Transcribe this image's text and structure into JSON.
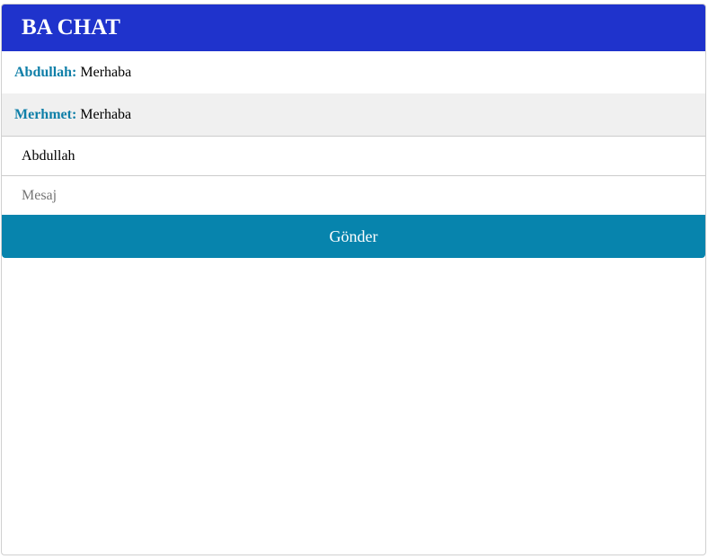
{
  "header": {
    "title": "BA CHAT"
  },
  "messages": [
    {
      "sender": "Abdullah:",
      "text": "Merhaba"
    },
    {
      "sender": "Merhmet:",
      "text": "Merhaba"
    }
  ],
  "form": {
    "name_value": "Abdullah",
    "name_placeholder": "",
    "message_value": "",
    "message_placeholder": "Mesaj",
    "send_label": "Gönder"
  },
  "colors": {
    "header_bg": "#1f33cc",
    "sender_color": "#0f7fa8",
    "button_bg": "#0784ad"
  }
}
